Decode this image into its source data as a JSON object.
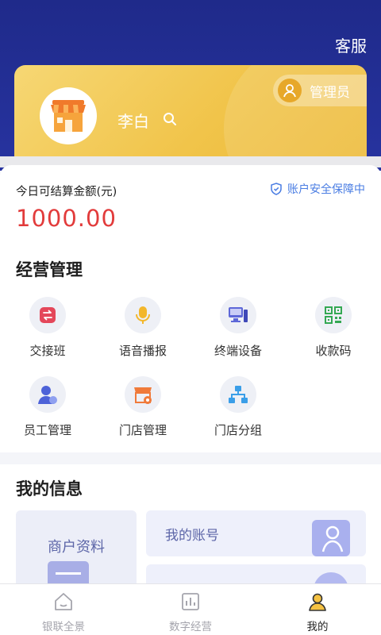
{
  "header": {
    "service_label": "客服"
  },
  "profile": {
    "name": "李白",
    "role": "管理员"
  },
  "balance": {
    "label": "今日可结算金额(元)",
    "value": "1000.00",
    "security_text": "账户安全保障中"
  },
  "business": {
    "title": "经营管理",
    "items": [
      {
        "label": "交接班",
        "icon": "shift-handover-icon",
        "color": "#e4475a"
      },
      {
        "label": "语音播报",
        "icon": "microphone-icon",
        "color": "#f3b72c"
      },
      {
        "label": "终端设备",
        "icon": "terminal-icon",
        "color": "#5d67d8"
      },
      {
        "label": "收款码",
        "icon": "qr-code-icon",
        "color": "#34a853"
      },
      {
        "label": "员工管理",
        "icon": "employee-icon",
        "color": "#4d62d8"
      },
      {
        "label": "门店管理",
        "icon": "store-manage-icon",
        "color": "#f07a3a"
      },
      {
        "label": "门店分组",
        "icon": "store-group-icon",
        "color": "#3a9ee8"
      }
    ]
  },
  "my_info": {
    "title": "我的信息",
    "merchant_label": "商户资料",
    "account_label": "我的账号"
  },
  "tabbar": {
    "items": [
      {
        "label": "银联全景",
        "icon": "home-icon",
        "active": false
      },
      {
        "label": "数字经营",
        "icon": "chart-icon",
        "active": false
      },
      {
        "label": "我的",
        "icon": "user-icon",
        "active": true
      }
    ]
  },
  "colors": {
    "header_bg": "#1f2a8a",
    "card_gold": "#f1c44a",
    "amount_red": "#e23b3b",
    "security_blue": "#4a7de3"
  }
}
